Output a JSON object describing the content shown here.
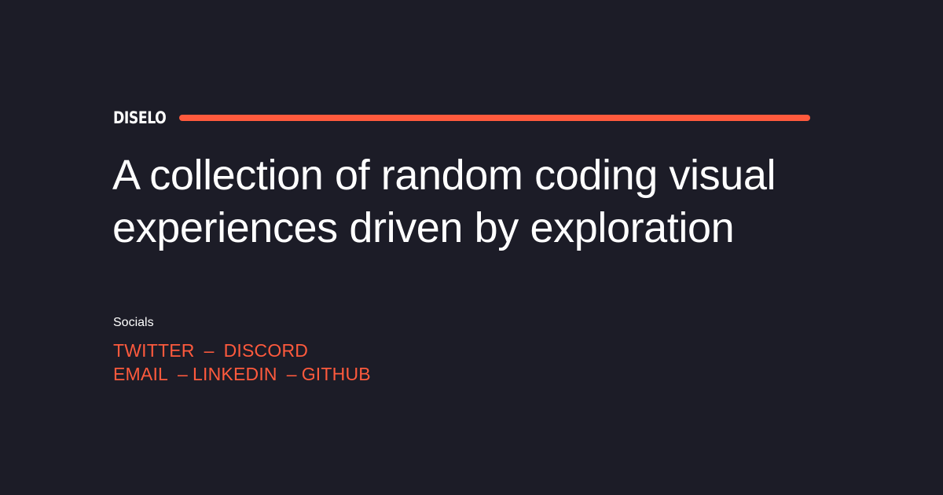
{
  "brand": {
    "name": "DISELO"
  },
  "headline": {
    "line1": "A collection of random coding visual",
    "line2": "experiences driven by exploration"
  },
  "socials": {
    "label": "Socials",
    "separator": "–",
    "row1": [
      "TWITTER",
      "DISCORD"
    ],
    "row2": [
      "EMAIL",
      "LINKEDIN",
      "GITHUB"
    ]
  },
  "colors": {
    "background": "#1c1c27",
    "accent": "#ff5a3d",
    "text": "#ffffff"
  }
}
